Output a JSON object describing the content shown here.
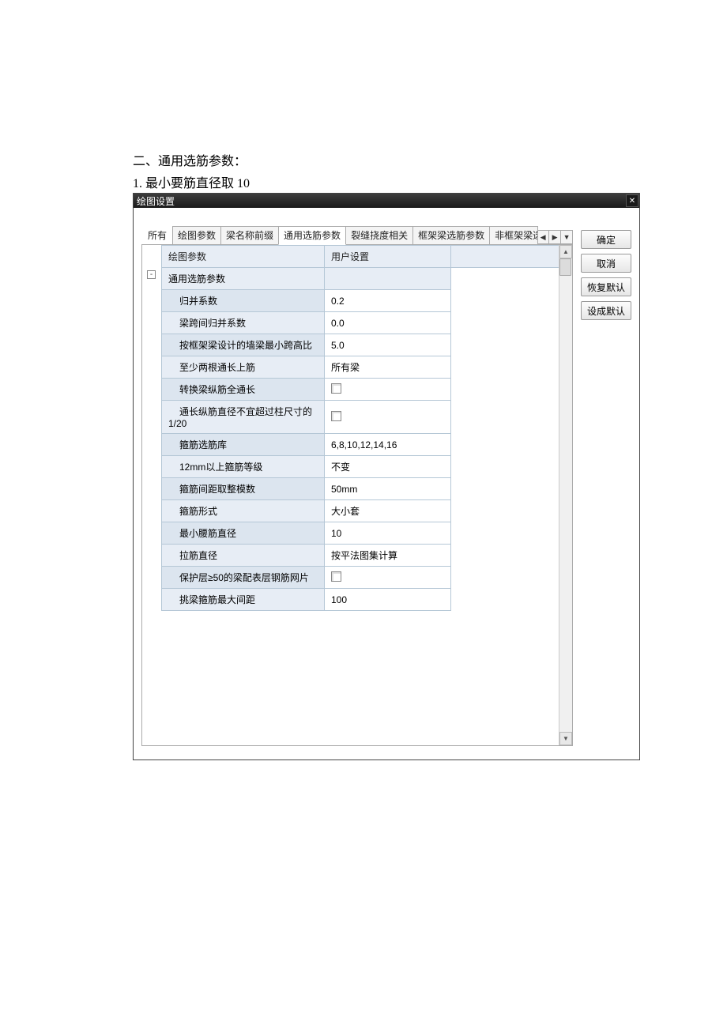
{
  "page": {
    "section_heading": "二、通用选筋参数：",
    "item_heading": "1. 最小要筋直径取 10"
  },
  "dialog": {
    "title": "绘图设置",
    "tabs": {
      "all": "所有",
      "items": [
        "绘图参数",
        "梁名称前缀",
        "通用选筋参数",
        "裂缝挠度相关",
        "框架梁选筋参数",
        "非框架梁选"
      ],
      "active_index": 2
    },
    "grid": {
      "headers": [
        "绘图参数",
        "用户设置"
      ],
      "group_row": "通用选筋参数",
      "rows": [
        {
          "label": "归并系数",
          "value": "0.2",
          "type": "text"
        },
        {
          "label": "梁跨间归并系数",
          "value": "0.0",
          "type": "text"
        },
        {
          "label": "按框架梁设计的墙梁最小跨高比",
          "value": "5.0",
          "type": "text"
        },
        {
          "label": "至少两根通长上筋",
          "value": "所有梁",
          "type": "text"
        },
        {
          "label": "转换梁纵筋全通长",
          "value": "",
          "type": "checkbox"
        },
        {
          "label": "通长纵筋直径不宜超过柱尺寸的1/20",
          "value": "",
          "type": "checkbox"
        },
        {
          "label": "箍筋选筋库",
          "value": "6,8,10,12,14,16",
          "type": "text"
        },
        {
          "label": "12mm以上箍筋等级",
          "value": "不变",
          "type": "text"
        },
        {
          "label": "箍筋间距取整模数",
          "value": "50mm",
          "type": "text"
        },
        {
          "label": "箍筋形式",
          "value": "大小套",
          "type": "text"
        },
        {
          "label": "最小腰筋直径",
          "value": "10",
          "type": "text"
        },
        {
          "label": "拉筋直径",
          "value": "按平法图集计算",
          "type": "text"
        },
        {
          "label": "保护层≥50的梁配表层钢筋网片",
          "value": "",
          "type": "checkbox"
        },
        {
          "label": "挑梁箍筋最大间距",
          "value": "100",
          "type": "text"
        }
      ]
    },
    "buttons": {
      "ok": "确定",
      "cancel": "取消",
      "restore": "恢复默认",
      "setdefault": "设成默认"
    },
    "tree_toggle": "-"
  }
}
